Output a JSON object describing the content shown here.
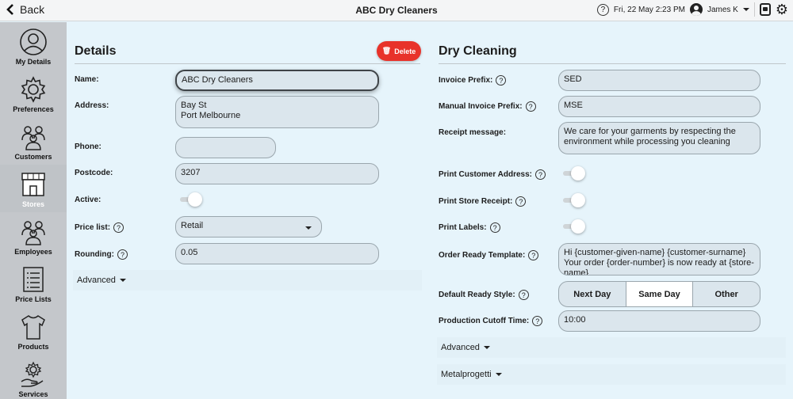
{
  "header": {
    "back_label": "Back",
    "title": "ABC Dry Cleaners",
    "datetime": "Fri, 22 May 2:23 PM",
    "user": "James K",
    "help": "?"
  },
  "sidebar": {
    "items": [
      {
        "label": "My Details",
        "icon": "user-circle-icon"
      },
      {
        "label": "Preferences",
        "icon": "gear-icon"
      },
      {
        "label": "Customers",
        "icon": "group-icon"
      },
      {
        "label": "Stores",
        "icon": "store-icon"
      },
      {
        "label": "Employees",
        "icon": "group-icon"
      },
      {
        "label": "Price Lists",
        "icon": "list-icon"
      },
      {
        "label": "Products",
        "icon": "shirt-icon"
      },
      {
        "label": "Services",
        "icon": "gear-hand-icon"
      }
    ]
  },
  "details": {
    "title": "Details",
    "delete_label": "Delete",
    "name_label": "Name:",
    "name": "ABC Dry Cleaners",
    "address_label": "Address:",
    "address_line1": "Bay St",
    "address_line2": "Port Melbourne",
    "phone_label": "Phone:",
    "phone": "",
    "postcode_label": "Postcode:",
    "postcode": "3207",
    "active_label": "Active:",
    "active": true,
    "price_list_label": "Price list:",
    "price_list": "Retail",
    "rounding_label": "Rounding:",
    "rounding": "0.05",
    "advanced_label": "Advanced"
  },
  "dry": {
    "title": "Dry Cleaning",
    "invoice_prefix_label": "Invoice Prefix:",
    "invoice_prefix": "SED",
    "manual_prefix_label": "Manual Invoice Prefix:",
    "manual_prefix": "MSE",
    "receipt_label": "Receipt message:",
    "receipt": "We care for your garments by respecting the environment while processing you cleaning",
    "print_address_label": "Print Customer Address:",
    "print_receipt_label": "Print Store Receipt:",
    "print_labels_label": "Print Labels:",
    "order_ready_label": "Order Ready Template:",
    "order_ready": "Hi {customer-given-name} {customer-surname} Your order {order-number} is now ready at {store-name}",
    "ready_style_label": "Default Ready Style:",
    "ready_options": [
      "Next Day",
      "Same Day",
      "Other"
    ],
    "ready_selected": "Same Day",
    "cutoff_label": "Production Cutoff Time:",
    "cutoff": "10:00",
    "advanced_label": "Advanced",
    "metal_label": "Metalprogetti"
  }
}
